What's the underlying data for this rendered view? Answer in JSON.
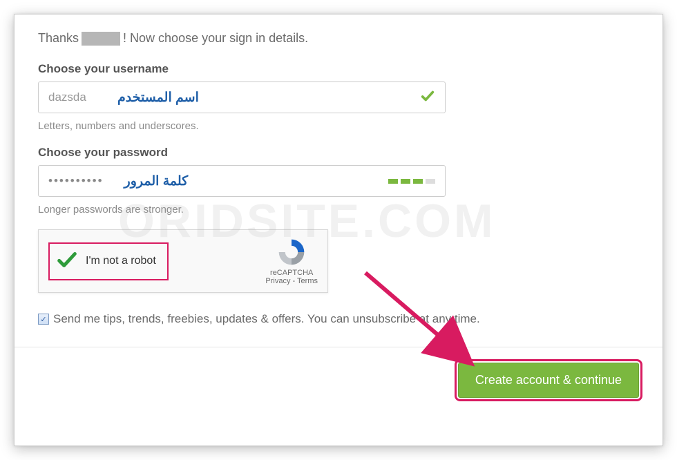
{
  "greeting": {
    "prefix": "Thanks",
    "suffix": "! Now choose your sign in details."
  },
  "username": {
    "label": "Choose your username",
    "value": "dazsda",
    "annotation_ar": "اسم المستخدم",
    "hint": "Letters, numbers and underscores."
  },
  "password": {
    "label": "Choose your password",
    "masked": "••••••••••",
    "annotation_ar": "كلمة المرور",
    "hint": "Longer passwords are stronger."
  },
  "captcha": {
    "text": "I'm not a robot",
    "brand": "reCAPTCHA",
    "links": "Privacy - Terms"
  },
  "optin": {
    "checked": true,
    "label": "Send me tips, trends, freebies, updates & offers. You can unsubscribe at any time."
  },
  "actions": {
    "primary": "Create account & continue"
  },
  "watermark": "ORIDSITE.COM"
}
